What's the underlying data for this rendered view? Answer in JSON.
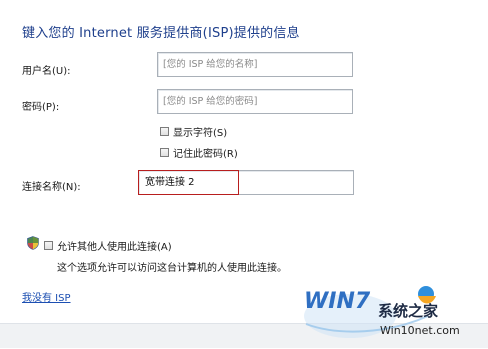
{
  "header": {
    "title": "键入您的 Internet 服务提供商(ISP)提供的信息"
  },
  "form": {
    "username": {
      "label": "用户名(U):",
      "placeholder": "[您的 ISP 给您的名称]"
    },
    "password": {
      "label": "密码(P):",
      "placeholder": "[您的 ISP 给您的密码]"
    },
    "show_chars": {
      "label": "显示字符(S)",
      "checked": false
    },
    "remember_password": {
      "label": "记住此密码(R)",
      "checked": false
    },
    "connection_name": {
      "label": "连接名称(N):",
      "value": "宽带连接 2"
    },
    "allow_others": {
      "label": "允许其他人使用此连接(A)",
      "checked": false,
      "description": "这个选项允许可以访问这台计算机的人使用此连接。"
    }
  },
  "footer": {
    "no_isp_link": "我没有 ISP"
  },
  "watermark": {
    "brand": "WIN7",
    "name": "系统之家",
    "site": "Win10net.com"
  },
  "colors": {
    "title": "#1e3f8c",
    "link": "#1c4fb2",
    "highlight_border": "#b81e1e"
  },
  "icons": {
    "shield": "uac-shield-icon"
  }
}
